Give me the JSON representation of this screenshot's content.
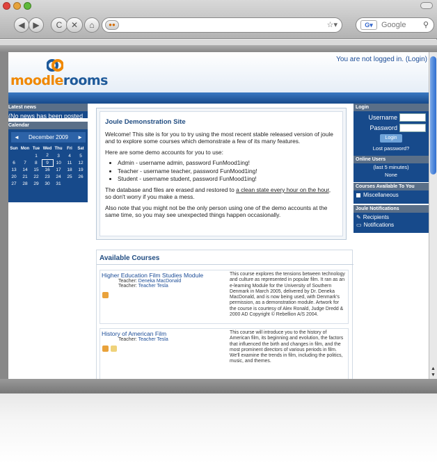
{
  "browser": {
    "back_icon": "back-arrow-icon",
    "forward_icon": "forward-arrow-icon",
    "reload_glyph": "C",
    "stop_glyph": "✕",
    "home_glyph": "⌂",
    "url": "",
    "search_placeholder": "Google",
    "bookmark_star": "☆▾"
  },
  "header": {
    "login_status": "You are not logged in. (Login)",
    "logo_part1": "moodle",
    "logo_part2": "rooms"
  },
  "left": {
    "news_title": "Latest news",
    "news_empty": "(No news has been posted yet)",
    "calendar_title": "Calendar",
    "month": "December 2009",
    "prev": "◄",
    "next": "►",
    "days": [
      "Sun",
      "Mon",
      "Tue",
      "Wed",
      "Thu",
      "Fri",
      "Sat"
    ],
    "weeks": [
      [
        "",
        "",
        "1",
        "2",
        "3",
        "4",
        "5"
      ],
      [
        "6",
        "7",
        "8",
        "9",
        "10",
        "11",
        "12"
      ],
      [
        "13",
        "14",
        "15",
        "16",
        "17",
        "18",
        "19"
      ],
      [
        "20",
        "21",
        "22",
        "23",
        "24",
        "25",
        "26"
      ],
      [
        "27",
        "28",
        "29",
        "30",
        "31",
        "",
        ""
      ]
    ],
    "today": "9"
  },
  "right": {
    "login_title": "Login",
    "username_label": "Username",
    "password_label": "Password",
    "login_button": "Login",
    "lost_password": "Lost password?",
    "online_title": "Online Users",
    "online_period": "(last 5 minutes)",
    "online_none": "None",
    "courses_title": "Courses Available To You",
    "course_category": "Miscellaneous",
    "notif_title": "Joule Notifications",
    "recipients": "Recipients",
    "notifications": "Notifications"
  },
  "intro": {
    "title": "Joule Demonstration Site",
    "p1": "Welcome! This site is for you to try using the most recent stable released version of joule and to explore some courses which demonstrate a few of its many features.",
    "p2": "Here are some demo accounts for you to use:",
    "accounts": [
      "Admin - username admin, password FunMood1ing!",
      "Teacher - username teacher, password FunMood1ing!",
      "Student - username student, password FunMood1ing!"
    ],
    "p3a": "The database and files are erased and restored to ",
    "p3link": "a clean state every hour on the hour",
    "p3b": ", so don't worry if you make a mess.",
    "p4": "Also note that you might not be the only person using one of the demo accounts at the same time, so you may see unexpected things happen occasionally."
  },
  "courses": {
    "title": "Available Courses",
    "items": [
      {
        "name": "Higher Education Film Studies Module",
        "teachers": [
          [
            "Teacher: ",
            "Deneka MacDonald"
          ],
          [
            "Teacher: ",
            "Teacher Tesla"
          ]
        ],
        "summary": "This course explores the tensions between technology and culture as represented in popular film. It ran as an e-learning Module for the University of Southern Denmark in March 2005, delivered by Dr. Deneka MacDonald, and is now being used, with Denmark's permission, as a demonstration module. Artwork for the course is courtesy of Alex Ronald, Judge Dredd & 2000 AD Copyright © Rebellion A/S 2004."
      },
      {
        "name": "History of American Film",
        "teachers": [
          [
            "Teacher: ",
            "Teacher Tesla"
          ]
        ],
        "summary": "This course will introduce you to the history of American film, its beginning and evolution, the factors that influenced the birth and changes in film, and the most prominent directors of various periods in film. We'll examine the trends in film, including the politics, music, and themes."
      }
    ]
  },
  "colors": {
    "accent": "#174a8b",
    "logo_orange": "#f08800",
    "link": "#1a4b96"
  }
}
